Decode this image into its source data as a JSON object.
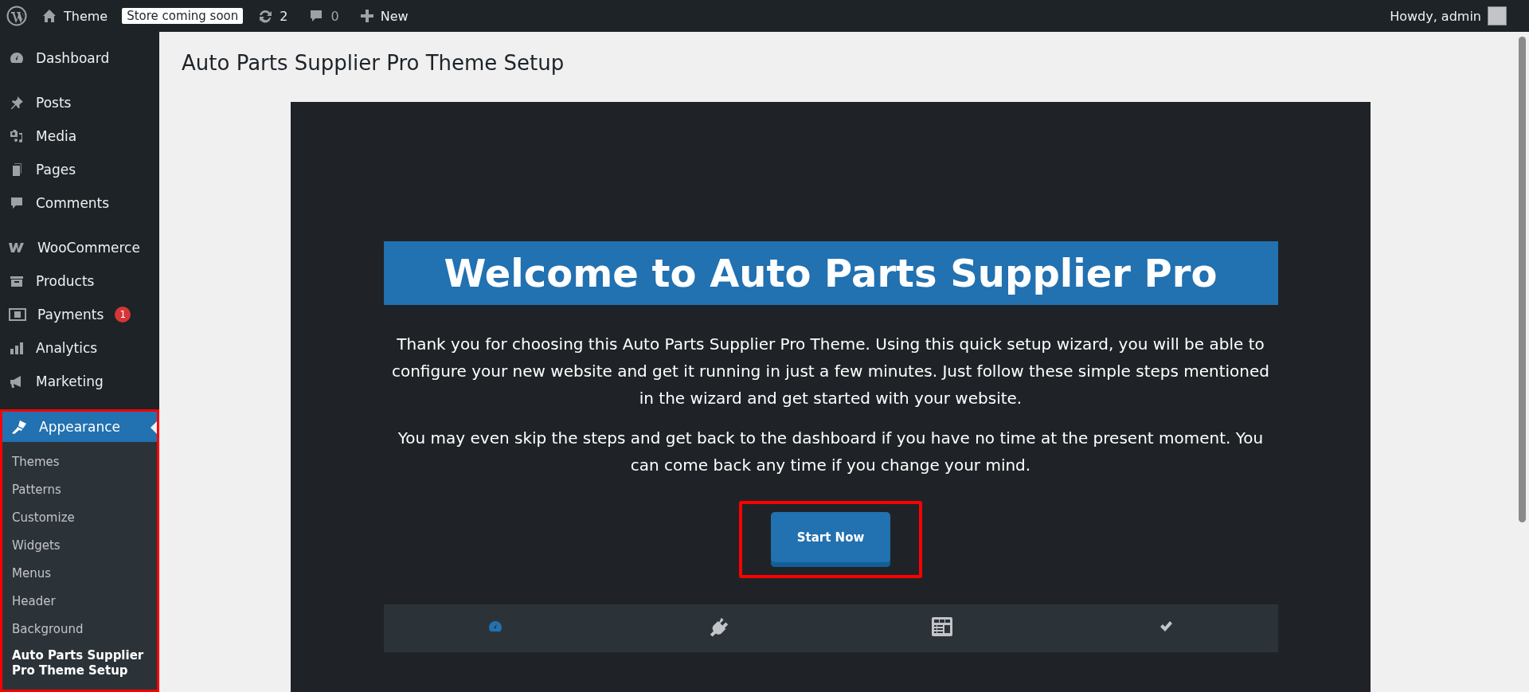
{
  "admin_bar": {
    "site_name": "Theme",
    "store_badge": "Store coming soon",
    "updates_count": "2",
    "comments_count": "0",
    "new_label": "New",
    "greeting": "Howdy, admin"
  },
  "sidebar": {
    "groups": [
      [
        {
          "label": "Dashboard"
        }
      ],
      [
        {
          "label": "Posts"
        },
        {
          "label": "Media"
        },
        {
          "label": "Pages"
        },
        {
          "label": "Comments"
        }
      ],
      [
        {
          "label": "WooCommerce"
        },
        {
          "label": "Products"
        },
        {
          "label": "Payments",
          "badge": "1"
        },
        {
          "label": "Analytics"
        },
        {
          "label": "Marketing"
        }
      ]
    ],
    "active_menu": {
      "label": "Appearance",
      "highlighted": true,
      "submenu": [
        {
          "label": "Themes",
          "selected": false
        },
        {
          "label": "Patterns",
          "selected": false
        },
        {
          "label": "Customize",
          "selected": false
        },
        {
          "label": "Widgets",
          "selected": false
        },
        {
          "label": "Menus",
          "selected": false
        },
        {
          "label": "Header",
          "selected": false
        },
        {
          "label": "Background",
          "selected": false
        },
        {
          "label": "Auto Parts Supplier Pro Theme Setup",
          "selected": true
        }
      ]
    }
  },
  "page_title": "Auto Parts Supplier Pro Theme Setup",
  "wizard": {
    "heading": "Welcome to Auto Parts Supplier Pro",
    "paragraphs": [
      "Thank you for choosing this Auto Parts Supplier Pro Theme. Using this quick setup wizard, you will be able to configure your new website and get it running in just a few minutes. Just follow these simple steps mentioned in the wizard and get started with your website.",
      "You may even skip the steps and get back to the dashboard if you have no time at the present moment. You can come back any time if you change your mind."
    ],
    "start_button": "Start Now",
    "start_highlighted": true,
    "steps": [
      {
        "selected": true
      },
      {
        "selected": false
      },
      {
        "selected": false
      },
      {
        "selected": false
      }
    ]
  }
}
